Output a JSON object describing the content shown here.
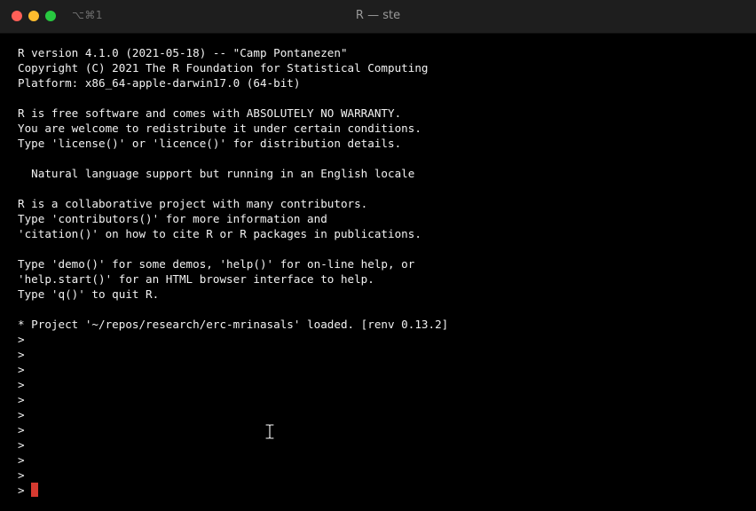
{
  "window": {
    "title": "R — ste",
    "shortcut": "⌥⌘1"
  },
  "terminal": {
    "lines": [
      "R version 4.1.0 (2021-05-18) -- \"Camp Pontanezen\"",
      "Copyright (C) 2021 The R Foundation for Statistical Computing",
      "Platform: x86_64-apple-darwin17.0 (64-bit)",
      "",
      "R is free software and comes with ABSOLUTELY NO WARRANTY.",
      "You are welcome to redistribute it under certain conditions.",
      "Type 'license()' or 'licence()' for distribution details.",
      "",
      "  Natural language support but running in an English locale",
      "",
      "R is a collaborative project with many contributors.",
      "Type 'contributors()' for more information and",
      "'citation()' on how to cite R or R packages in publications.",
      "",
      "Type 'demo()' for some demos, 'help()' for on-line help, or",
      "'help.start()' for an HTML browser interface to help.",
      "Type 'q()' to quit R.",
      "",
      "* Project '~/repos/research/erc-mrinasals' loaded. [renv 0.13.2]",
      ">",
      ">",
      ">",
      ">",
      ">",
      ">",
      ">",
      ">",
      ">",
      ">"
    ],
    "prompt": ">",
    "cursor_color": "#d63a30"
  },
  "icons": {
    "mouse_cursor": "ibeam-cursor-icon"
  }
}
